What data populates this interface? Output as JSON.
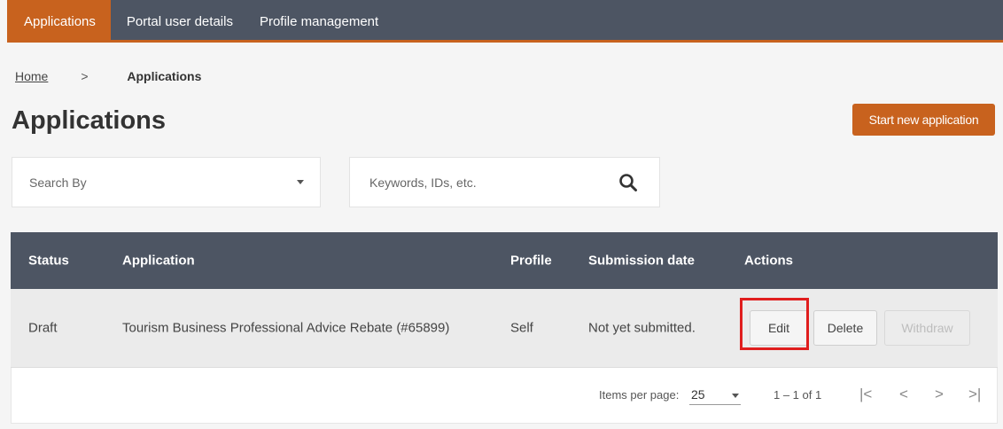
{
  "nav": {
    "tabs": [
      {
        "label": "Applications",
        "active": true
      },
      {
        "label": "Portal user details",
        "active": false
      },
      {
        "label": "Profile management",
        "active": false
      }
    ]
  },
  "breadcrumb": {
    "home": "Home",
    "separator": ">",
    "current": "Applications"
  },
  "page": {
    "title": "Applications",
    "start_button": "Start new application"
  },
  "search": {
    "search_by_label": "Search By",
    "keyword_placeholder": "Keywords, IDs, etc."
  },
  "table": {
    "headers": {
      "status": "Status",
      "application": "Application",
      "profile": "Profile",
      "submission_date": "Submission date",
      "actions": "Actions"
    },
    "rows": [
      {
        "status": "Draft",
        "application": "Tourism Business Professional Advice Rebate (#65899)",
        "profile": "Self",
        "submission_date": "Not yet submitted.",
        "actions": {
          "edit": "Edit",
          "delete": "Delete",
          "withdraw": "Withdraw"
        }
      }
    ]
  },
  "pagination": {
    "items_per_page_label": "Items per page:",
    "items_per_page_value": "25",
    "range": "1 – 1 of 1",
    "first": "|<",
    "prev": "<",
    "next": ">",
    "last": ">|"
  },
  "colors": {
    "accent": "#c8621e",
    "nav_bg": "#4d5563",
    "highlight": "#e01e1e"
  }
}
